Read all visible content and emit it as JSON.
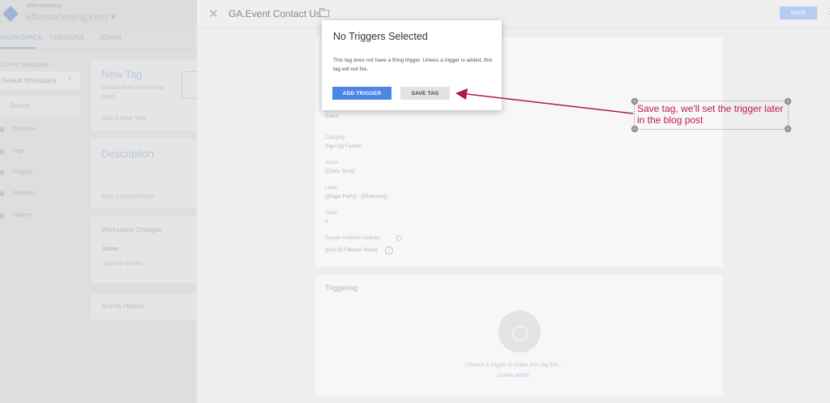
{
  "background": {
    "account_small": "efflemarketing",
    "account_name": "efflemarketing.com ▾",
    "nav_tabs": [
      "WORKSPACE",
      "VERSIONS",
      "ADMIN"
    ],
    "workspace_label": "Current Workspace",
    "workspace_name": "Default Workspace",
    "search_placeholder": "Search",
    "sidebar": [
      "Overview",
      "Tags",
      "Triggers",
      "Variables",
      "Folders"
    ],
    "new_tag": {
      "title": "New Tag",
      "subtitle": "Choose from over 50 tag types.",
      "link": "ADD A NEW TAG"
    },
    "description": {
      "title": "Description",
      "link": "EDIT DESCRIPTION"
    },
    "workspace_changes": {
      "title": "Workspace Changes",
      "column": "Name ↑",
      "rows": [
        "Sign Up Events"
      ]
    },
    "activity_history": "Activity History"
  },
  "header": {
    "tag_name": "GA.Event Contact Us",
    "save_label": "SAVE"
  },
  "config": {
    "fields": [
      {
        "label": "",
        "value": "Event"
      },
      {
        "label": "Category",
        "value": "Sign Up Funnel"
      },
      {
        "label": "Action",
        "value": "{{Click Text}}"
      },
      {
        "label": "Label",
        "value": "{{Page Path}} : {{Referrer}}"
      },
      {
        "label": "Value",
        "value": "0"
      },
      {
        "label": "Google Analytics Settings",
        "value": "{{UA ID Filtered View}}"
      }
    ]
  },
  "triggering": {
    "title": "Triggering",
    "prompt": "Choose a trigger to make this tag fire...",
    "link": "LEARN MORE"
  },
  "dialog": {
    "title": "No Triggers Selected",
    "body": "This tag does not have a firing trigger. Unless a trigger is added, this tag will not fire.",
    "add_trigger": "ADD TRIGGER",
    "save_tag": "SAVE TAG"
  },
  "annotation": {
    "text": "Save tag, we'll set the trigger later in the blog post",
    "color": "#c2185b"
  }
}
